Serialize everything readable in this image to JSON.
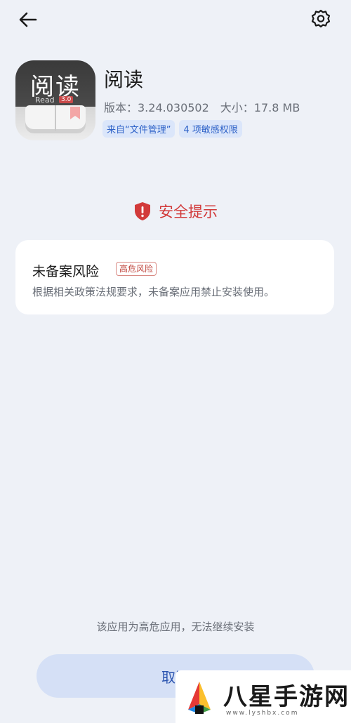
{
  "app": {
    "icon": {
      "glyph": "阅读",
      "brand": "Read",
      "version_chip": "3.0"
    },
    "name": "阅读",
    "version": "版本：3.24.030502",
    "size": "大小：17.8 MB",
    "tags": [
      "来自“文件管理”",
      "4 项敏感权限"
    ]
  },
  "security": {
    "title": "安全提示",
    "icon": "shield-alert-icon",
    "risk": {
      "title": "未备案风险",
      "badge": "高危风险",
      "description": "根据相关政策法规要求，未备案应用禁止安装使用。"
    }
  },
  "footer": {
    "note": "该应用为高危应用，无法继续安装",
    "cancel_label": "取消"
  },
  "watermark": {
    "text": "八星手游网",
    "url": "www.lyshbx.com"
  },
  "colors": {
    "background": "#eef1f7",
    "danger": "#d23a3a",
    "accent": "#2f63c8",
    "tag_bg": "#dbe6fa",
    "button_bg": "#d5e0f6"
  }
}
